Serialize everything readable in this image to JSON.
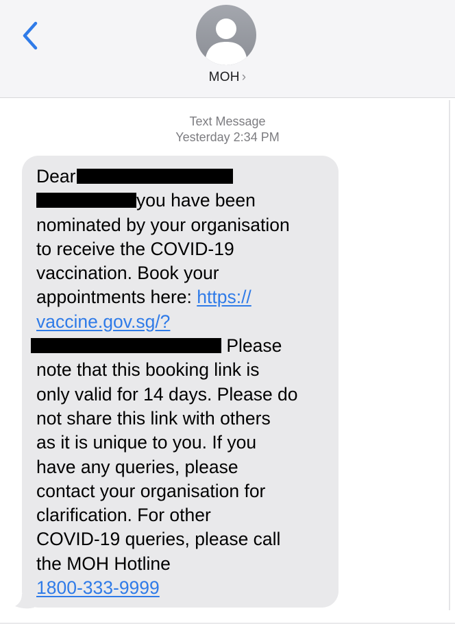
{
  "header": {
    "back_icon": "chevron-left-icon",
    "contact_name": "MOH",
    "contact_chevron": "›",
    "avatar_icon": "person-icon"
  },
  "conversation": {
    "meta_type": "Text Message",
    "meta_time": "Yesterday 2:34 PM"
  },
  "message": {
    "line_1_prefix": "Dear",
    "line_2_suffix": "you have been",
    "line_3": "nominated by your organisation",
    "line_4": "to receive the COVID-19",
    "line_5": "vaccination. Book your",
    "line_6_text": "appointments here:",
    "link_part_1": "https://",
    "link_part_2": "vaccine.gov.sg/?",
    "line_8_suffix": "Please",
    "line_9": "note that this booking link is",
    "line_10": "only valid for 14 days. Please do",
    "line_11": "not share this link with others",
    "line_12": "as it is unique to you. If you",
    "line_13": "have any queries, please",
    "line_14": "contact your organisation for",
    "line_15": "clarification. For other",
    "line_16": "COVID-19 queries, please call",
    "line_17": "the MOH Hotline",
    "hotline": "1800-333-9999"
  },
  "colors": {
    "link": "#2f7be8",
    "bubble": "#e9e9eb",
    "header_bg": "#f5f5f7",
    "back_chevron": "#2f7be8"
  }
}
